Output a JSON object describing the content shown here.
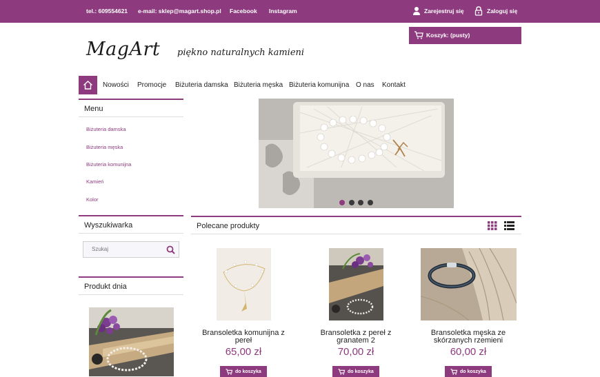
{
  "topbar": {
    "phone": "tel.: 609554621",
    "email": "e-mail: sklep@magart.shop.pl",
    "facebook": "Facebook",
    "instagram": "Instagram",
    "register": "Zarejestruj się",
    "login": "Zaloguj się"
  },
  "header": {
    "logo": "MagArt",
    "tagline": "piękno naturalnych kamieni"
  },
  "cart": {
    "label": "Koszyk: (pusty)"
  },
  "nav": {
    "items": [
      "Nowości",
      "Promocje",
      "Biżuteria damska",
      "Biżuteria męska",
      "Biżuteria komunijna",
      "O nas",
      "Kontakt"
    ]
  },
  "sidebar": {
    "menu_title": "Menu",
    "menu_items": [
      "Biżuteria damska",
      "Biżuteria męska",
      "Biżuteria komunijna",
      "Kamień",
      "Kolor"
    ],
    "search_title": "Wyszukiwarka",
    "search_placeholder": "Szukaj",
    "daily_title": "Produkt dnia"
  },
  "slider": {
    "active_index": 0,
    "count": 4
  },
  "products": {
    "title": "Polecane produkty",
    "items": [
      {
        "name_line1": "Bransoletka komunijna z",
        "name_line2": "pereł",
        "price": "65,00 zł",
        "button": "do koszyka"
      },
      {
        "name_line1": "Bransoletka z pereł z",
        "name_line2": "granatem 2",
        "price": "70,00 zł",
        "button": "do koszyka"
      },
      {
        "name_line1": "Bransoletka męska ze",
        "name_line2": "skórzanych rzemieni",
        "price": "60,00 zł",
        "button": "do koszyka"
      }
    ]
  },
  "colors": {
    "accent": "#8e3a7e"
  }
}
